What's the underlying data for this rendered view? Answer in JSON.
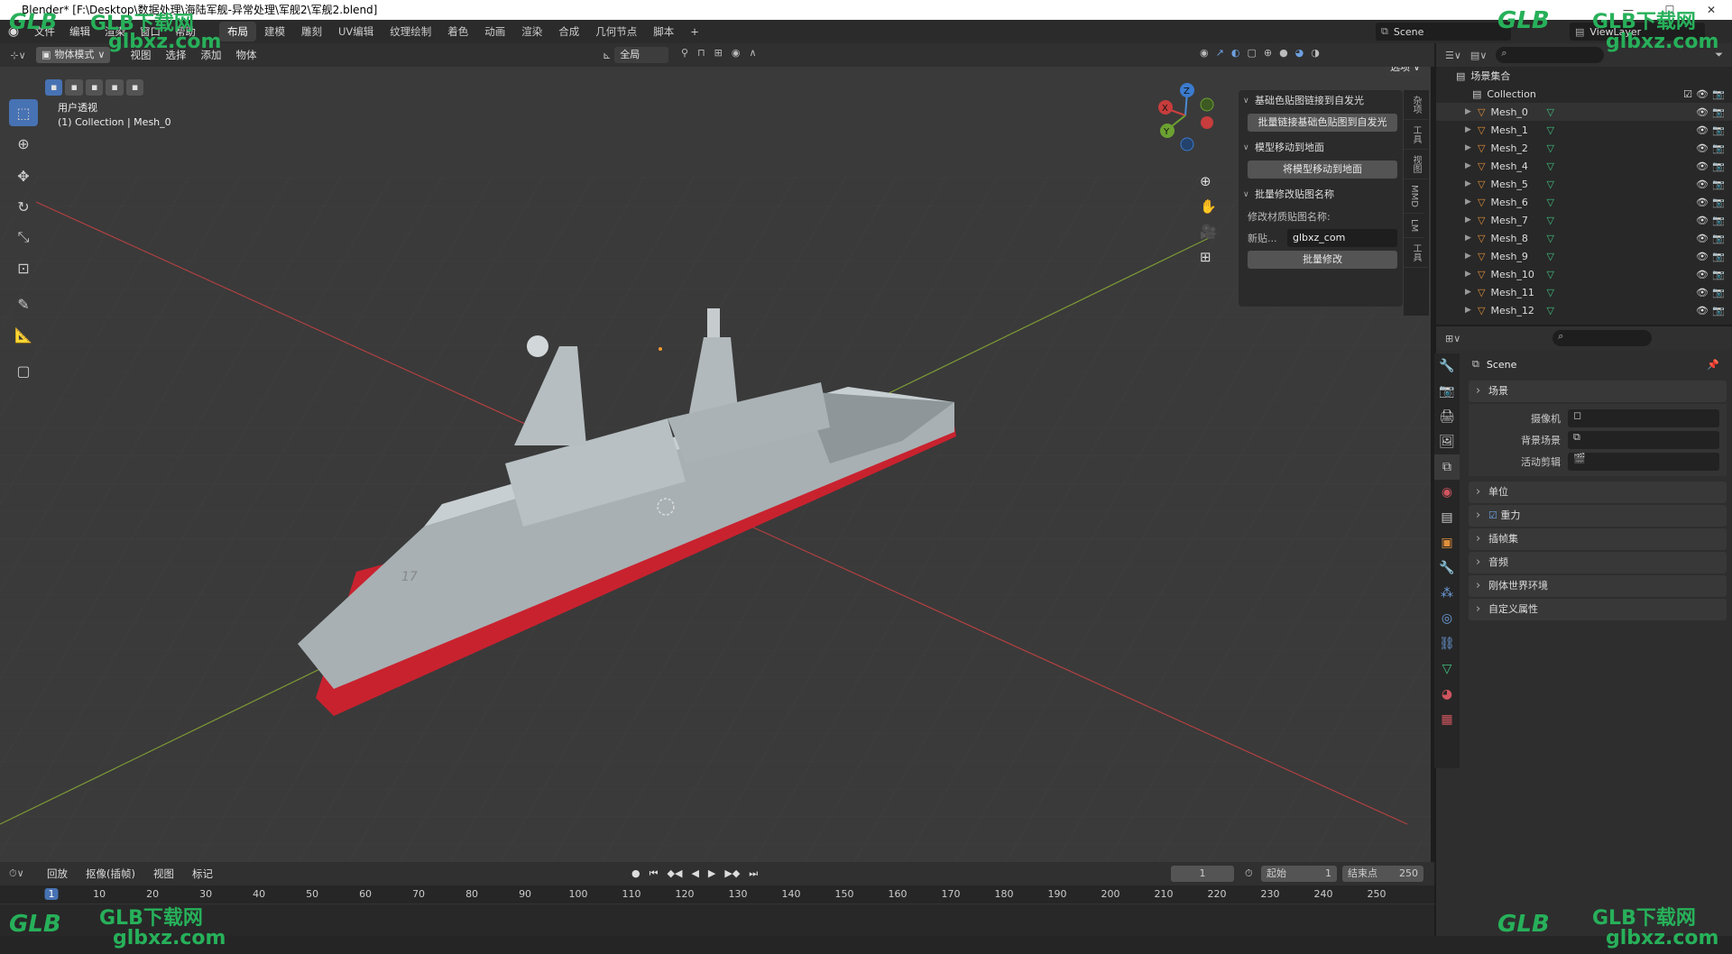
{
  "titlebar": {
    "title": "Blender* [F:\\Desktop\\数据处理\\海陆军舰-异常处理\\军舰2\\军舰2.blend]"
  },
  "topbar": {
    "menus": [
      "文件",
      "编辑",
      "渲染",
      "窗口",
      "帮助"
    ],
    "workspaces": [
      "布局",
      "建模",
      "雕刻",
      "UV编辑",
      "纹理绘制",
      "着色",
      "动画",
      "渲染",
      "合成",
      "几何节点",
      "脚本"
    ],
    "add_tab": "+",
    "scene": "Scene",
    "viewlayer": "ViewLayer"
  },
  "viewport_header": {
    "mode": "物体模式",
    "menus": [
      "视图",
      "选择",
      "添加",
      "物体"
    ],
    "transform": "全局",
    "options": "选项"
  },
  "viewport": {
    "view_name": "用户透视",
    "collection_info": "(1) Collection | Mesh_0",
    "gizmo": {
      "x": "X",
      "y": "Y",
      "z": "Z"
    }
  },
  "npanel": {
    "sections": [
      {
        "title": "基础色贴图链接到自发光",
        "button": "批量链接基础色贴图到自发光"
      },
      {
        "title": "模型移动到地面",
        "button": "将模型移动到地面"
      },
      {
        "title": "批量修改贴图名称",
        "label": "修改材质贴图名称:",
        "field_label": "新贴...",
        "field_value": "glbxz_com",
        "button": "批量修改"
      }
    ],
    "tabs": [
      "杂项",
      "工具",
      "视图",
      "MMD",
      "LM",
      "工具"
    ]
  },
  "outliner": {
    "root": "场景集合",
    "collection": "Collection",
    "items": [
      "Mesh_0",
      "Mesh_1",
      "Mesh_2",
      "Mesh_4",
      "Mesh_5",
      "Mesh_6",
      "Mesh_7",
      "Mesh_8",
      "Mesh_9",
      "Mesh_10",
      "Mesh_11",
      "Mesh_12"
    ]
  },
  "properties": {
    "scene_name": "Scene",
    "section_open": "场景",
    "fields": [
      {
        "label": "摄像机",
        "value": ""
      },
      {
        "label": "背景场景",
        "value": ""
      },
      {
        "label": "活动剪辑",
        "value": ""
      }
    ],
    "sections": [
      "单位",
      "重力",
      "插帧集",
      "音频",
      "刚体世界环境",
      "自定义属性"
    ]
  },
  "timeline": {
    "menus": [
      "回放",
      "抠像(插帧)",
      "视图",
      "标记"
    ],
    "current_frame": "1",
    "start_label": "起始",
    "start": "1",
    "end_label": "结束点",
    "end": "250",
    "ruler": [
      "1",
      "10",
      "20",
      "30",
      "40",
      "50",
      "60",
      "70",
      "80",
      "90",
      "100",
      "110",
      "120",
      "130",
      "140",
      "150",
      "160",
      "170",
      "180",
      "190",
      "200",
      "210",
      "220",
      "230",
      "240",
      "250"
    ]
  },
  "watermark": {
    "brand": "GLB下载网",
    "site": "glbxz.com",
    "logo": "GLB"
  }
}
